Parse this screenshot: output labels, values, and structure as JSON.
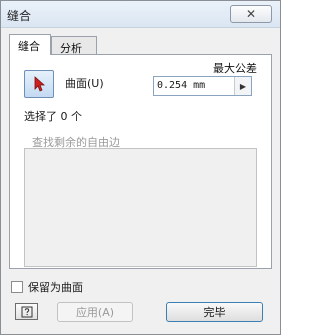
{
  "window": {
    "title": "缝合",
    "close_glyph": "✕"
  },
  "tabs": [
    {
      "label": "缝合",
      "active": true
    },
    {
      "label": "分析",
      "active": false
    }
  ],
  "panel": {
    "max_tolerance_label": "最大公差",
    "surface_label": "曲面(U)",
    "tolerance_value": "0.254 mm",
    "tolerance_arrow": "▶",
    "selected_count_text": "选择了 0 个",
    "find_edges_label": "查找剩余的自由边"
  },
  "options": {
    "keep_as_surface_label": "保留为曲面",
    "keep_as_surface_checked": false
  },
  "buttons": {
    "help_icon": "help-icon",
    "apply_label": "应用(A)",
    "done_label": "完毕"
  },
  "colors": {
    "select_button_fill": "#c4daf2",
    "cursor_red": "#d01f1f",
    "done_border": "#3c7fb1"
  }
}
